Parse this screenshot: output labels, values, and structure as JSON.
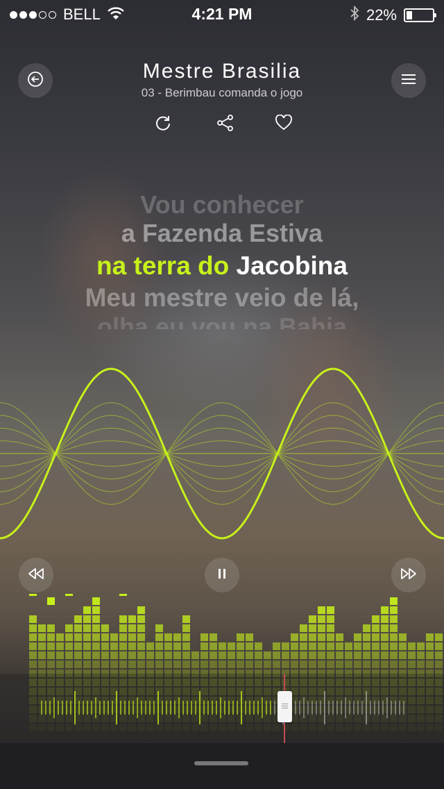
{
  "status_bar": {
    "carrier": "BELL",
    "signal_dots": 5,
    "signal_filled": 3,
    "time": "4:21 PM",
    "battery_text": "22%",
    "battery_level": 0.22
  },
  "header": {
    "artist": "Mestre Brasilia",
    "track": "03 - Berimbau comanda o jogo"
  },
  "icons": {
    "back": "back-circle-arrow-icon",
    "menu": "hamburger-menu-icon",
    "repeat": "repeat-icon",
    "share": "share-icon",
    "like": "heart-icon",
    "rewind": "rewind-icon",
    "pause": "pause-icon",
    "forward": "fast-forward-icon"
  },
  "lyrics": {
    "prev2": "Vou conhecer",
    "prev1": "a Fazenda Estiva",
    "current_sung": "na terra do",
    "current_rest": "Jacobina",
    "next1": "Meu mestre veio de lá,",
    "next2": "olha eu vou na Bahia"
  },
  "colors": {
    "accent": "#c7f11a",
    "playhead": "#c44a55"
  },
  "playback": {
    "state": "playing",
    "progress": 0.64
  },
  "equalizer": {
    "levels": [
      5,
      4,
      4,
      3,
      4,
      5,
      6,
      7,
      4,
      3,
      5,
      5,
      6,
      2,
      4,
      3,
      3,
      5,
      1,
      3,
      3,
      2,
      2,
      3,
      3,
      2,
      1,
      2,
      2,
      3,
      4,
      5,
      6,
      6,
      3,
      2,
      3,
      4,
      5,
      6,
      7,
      3,
      2,
      2,
      3,
      3,
      3,
      4,
      5,
      6,
      7
    ],
    "peaks": [
      7,
      0,
      6,
      0,
      7,
      0,
      8,
      10,
      8,
      0,
      7,
      0,
      0,
      0,
      0,
      0,
      0,
      0,
      0,
      10,
      0,
      0,
      0,
      0,
      0,
      0,
      0,
      0,
      0,
      0,
      0,
      0,
      0,
      0,
      0,
      0,
      0,
      0,
      0,
      0,
      0,
      0,
      0,
      0,
      0,
      0,
      0,
      0,
      0,
      8,
      10
    ]
  }
}
